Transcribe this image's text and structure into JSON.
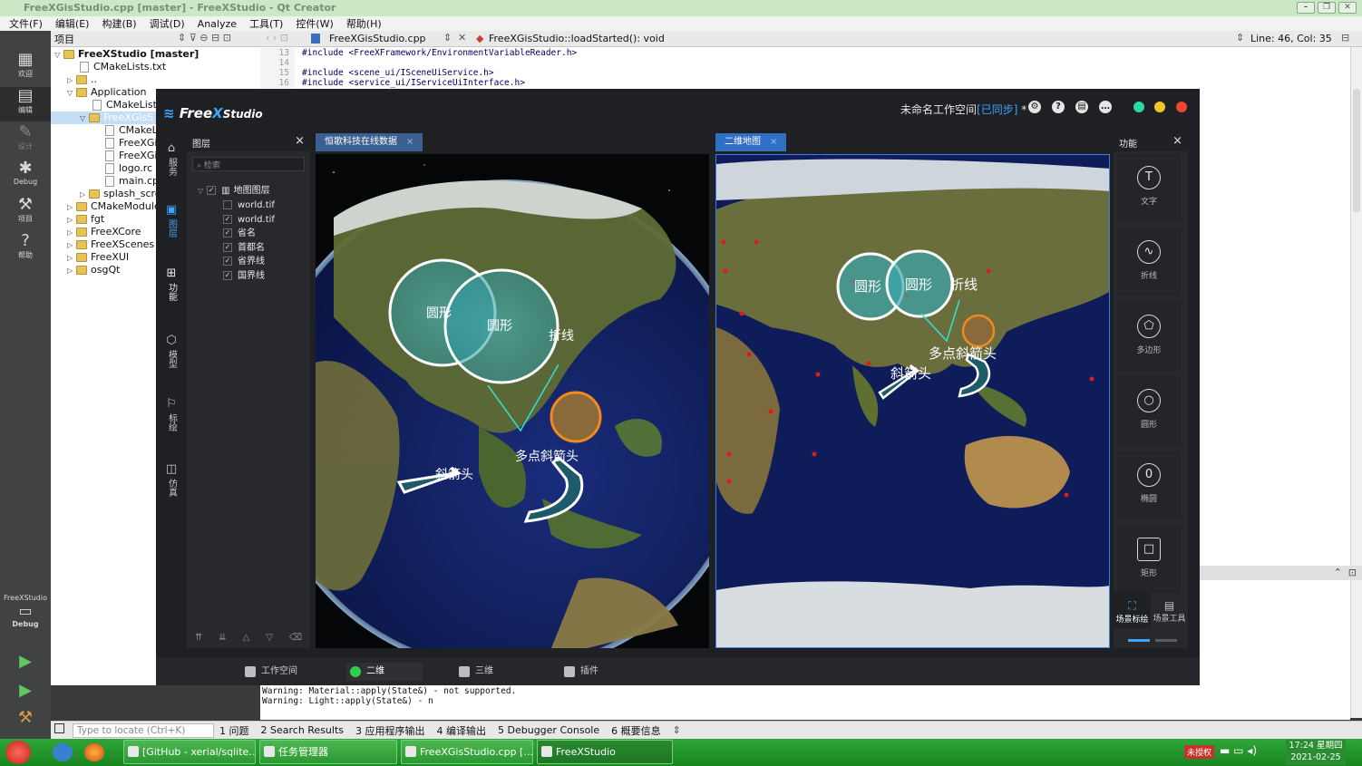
{
  "window": {
    "title": "FreeXGisStudio.cpp [master] - FreeXStudio - Qt Creator",
    "buttons": [
      "–",
      "❐",
      "✕"
    ]
  },
  "menu": [
    "文件(F)",
    "编辑(E)",
    "构建(B)",
    "调试(D)",
    "Analyze",
    "工具(T)",
    "控件(W)",
    "帮助(H)"
  ],
  "modes": [
    {
      "label": "欢迎",
      "icon": "grid-icon"
    },
    {
      "label": "编辑",
      "icon": "edit-icon"
    },
    {
      "label": "设计",
      "icon": "pen-icon"
    },
    {
      "label": "Debug",
      "icon": "bug-icon"
    },
    {
      "label": "项目",
      "icon": "wrench-icon"
    },
    {
      "label": "帮助",
      "icon": "help-icon"
    }
  ],
  "kit": {
    "project": "FreeXStudio",
    "mode": "Debug"
  },
  "project_panel": {
    "header": "项目",
    "tree": [
      "FreeXStudio [master]",
      "CMakeLists.txt",
      "..",
      "Application",
      "CMakeLists.",
      "FreeXGisS",
      "CMakeLi",
      "FreeXGis",
      "FreeXGis",
      "logo.rc",
      "main.cp",
      "splash_scre",
      "CMakeModules",
      "fgt",
      "FreeXCore",
      "FreeXScenes",
      "FreeXUI",
      "osgQt"
    ]
  },
  "editor": {
    "file": "FreeXGisStudio.cpp",
    "symbol": "FreeXGisStudio::loadStarted(): void",
    "position": "Line: 46, Col: 35",
    "lines": [
      {
        "no": "13",
        "text": "#include <FreeXFramework/EnvironmentVariableReader.h>"
      },
      {
        "no": "14",
        "text": ""
      },
      {
        "no": "15",
        "text": "#include <scene_ui/ISceneUiService.h>"
      },
      {
        "no": "16",
        "text": "#include <service_ui/IServiceUiInterface.h>"
      }
    ]
  },
  "output_lines": [
    "Warning: Material::apply(State&) - not supported.",
    "Warning: Light::apply(State&) - n"
  ],
  "bottom_panes": {
    "locator_placeholder": "Type to locate (Ctrl+K)",
    "items": [
      "1 问题",
      "2 Search Results",
      "3 应用程序输出",
      "4 编译输出",
      "5 Debugger Console",
      "6 概要信息"
    ]
  },
  "taskbar": {
    "items": [
      "[GitHub - xerial/sqlite…",
      "任务管理器",
      "FreeXGisStudio.cpp [...",
      "FreeXStudio"
    ],
    "tray_badge": "未授权",
    "time": "17:24 星期四",
    "date": "2021-02-25"
  },
  "app": {
    "logo_pre": "Free",
    "logo_x": "X",
    "logo_post": "Studio",
    "workspace": "未命名工作空间",
    "sync": "[已同步]",
    "star": " *",
    "top_icons": [
      "⚙",
      "?",
      "▤",
      "…"
    ],
    "side": [
      {
        "label": "服务",
        "icon": "server-icon"
      },
      {
        "label": "图层",
        "icon": "layers-icon"
      },
      {
        "label": "功能",
        "icon": "function-icon"
      },
      {
        "label": "模型",
        "icon": "cube-icon"
      },
      {
        "label": "标绘",
        "icon": "flag-icon"
      },
      {
        "label": "仿真",
        "icon": "sim-icon"
      }
    ],
    "layers_panel": {
      "title": "图层",
      "search_placeholder": "检索",
      "root": "地图图层",
      "items": [
        {
          "name": "world.tif",
          "checked": false
        },
        {
          "name": "world.tif",
          "checked": true
        },
        {
          "name": "省名",
          "checked": true
        },
        {
          "name": "首都名",
          "checked": true
        },
        {
          "name": "省界线",
          "checked": true
        },
        {
          "name": "国界线",
          "checked": true
        }
      ]
    },
    "tab_3d": "恒歌科技在线数据",
    "tab_2d": "二维地图",
    "tab_close": "×",
    "labels_3d": {
      "circle1": "圆形",
      "circle2": "圆形",
      "polyline": "折线",
      "multi_arrow": "多点斜箭头",
      "arrow": "斜箭头"
    },
    "labels_2d": {
      "circle1": "圆形",
      "circle2": "圆形",
      "polyline": "折线",
      "multi_arrow": "多点斜箭头",
      "arrow": "斜箭头"
    },
    "func_panel": {
      "title": "功能",
      "tools": [
        {
          "label": "文字",
          "icon": "text-icon",
          "glyph": "T"
        },
        {
          "label": "折线",
          "icon": "polyline-icon",
          "glyph": "∿"
        },
        {
          "label": "多边形",
          "icon": "polygon-icon",
          "glyph": "⬠"
        },
        {
          "label": "圆形",
          "icon": "circle-icon",
          "glyph": "○"
        },
        {
          "label": "椭圆",
          "icon": "ellipse-icon",
          "glyph": "0"
        },
        {
          "label": "矩形",
          "icon": "rectangle-icon",
          "glyph": "□"
        }
      ],
      "tabs": [
        "场景标绘",
        "场景工具"
      ]
    },
    "bottom_tabs": [
      "工作空间",
      "二维",
      "三维",
      "插件"
    ]
  }
}
